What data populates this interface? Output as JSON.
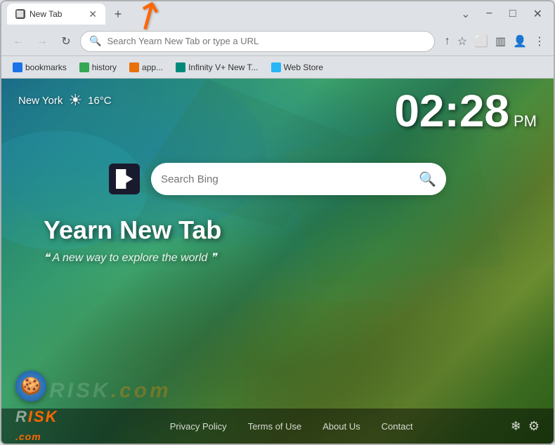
{
  "browser": {
    "tab_title": "New Tab",
    "tab_favicon": "page-icon",
    "new_tab_btn": "+",
    "window_controls": {
      "minimize": "−",
      "maximize": "□",
      "close": "✕"
    }
  },
  "address_bar": {
    "back_btn": "←",
    "forward_btn": "→",
    "refresh_btn": "↻",
    "placeholder": "Search Yearn New Tab or type a URL",
    "share_icon": "↑",
    "star_icon": "☆",
    "extensions_icon": "⬜",
    "split_icon": "▥",
    "profile_icon": "👤",
    "menu_icon": "⋮"
  },
  "bookmarks": [
    {
      "id": "bookmarks",
      "label": "bookmarks",
      "color": "blue"
    },
    {
      "id": "history",
      "label": "history",
      "color": "green"
    },
    {
      "id": "apps",
      "label": "app...",
      "color": "orange"
    },
    {
      "id": "infinity",
      "label": "Infinity V+ New T...",
      "color": "teal"
    },
    {
      "id": "webstore",
      "label": "Web Store",
      "color": "lightblue"
    }
  ],
  "page": {
    "weather": {
      "city": "New York",
      "temp": "16°C",
      "icon": "☀"
    },
    "clock": {
      "time": "02:28",
      "ampm": "PM"
    },
    "search": {
      "placeholder": "Search Bing",
      "magnifier": "🔍"
    },
    "app_title": "Yearn New Tab",
    "app_subtitle": "❝ A new way to explore the world ❞",
    "footer": {
      "logo_text": "RISK",
      "logo_domain": ".com",
      "links": [
        {
          "id": "privacy",
          "label": "Privacy Policy"
        },
        {
          "id": "terms",
          "label": "Terms of Use"
        },
        {
          "id": "about",
          "label": "About Us"
        },
        {
          "id": "contact",
          "label": "Contact"
        }
      ],
      "icon_snowflake": "❄",
      "icon_settings": "⚙"
    }
  }
}
